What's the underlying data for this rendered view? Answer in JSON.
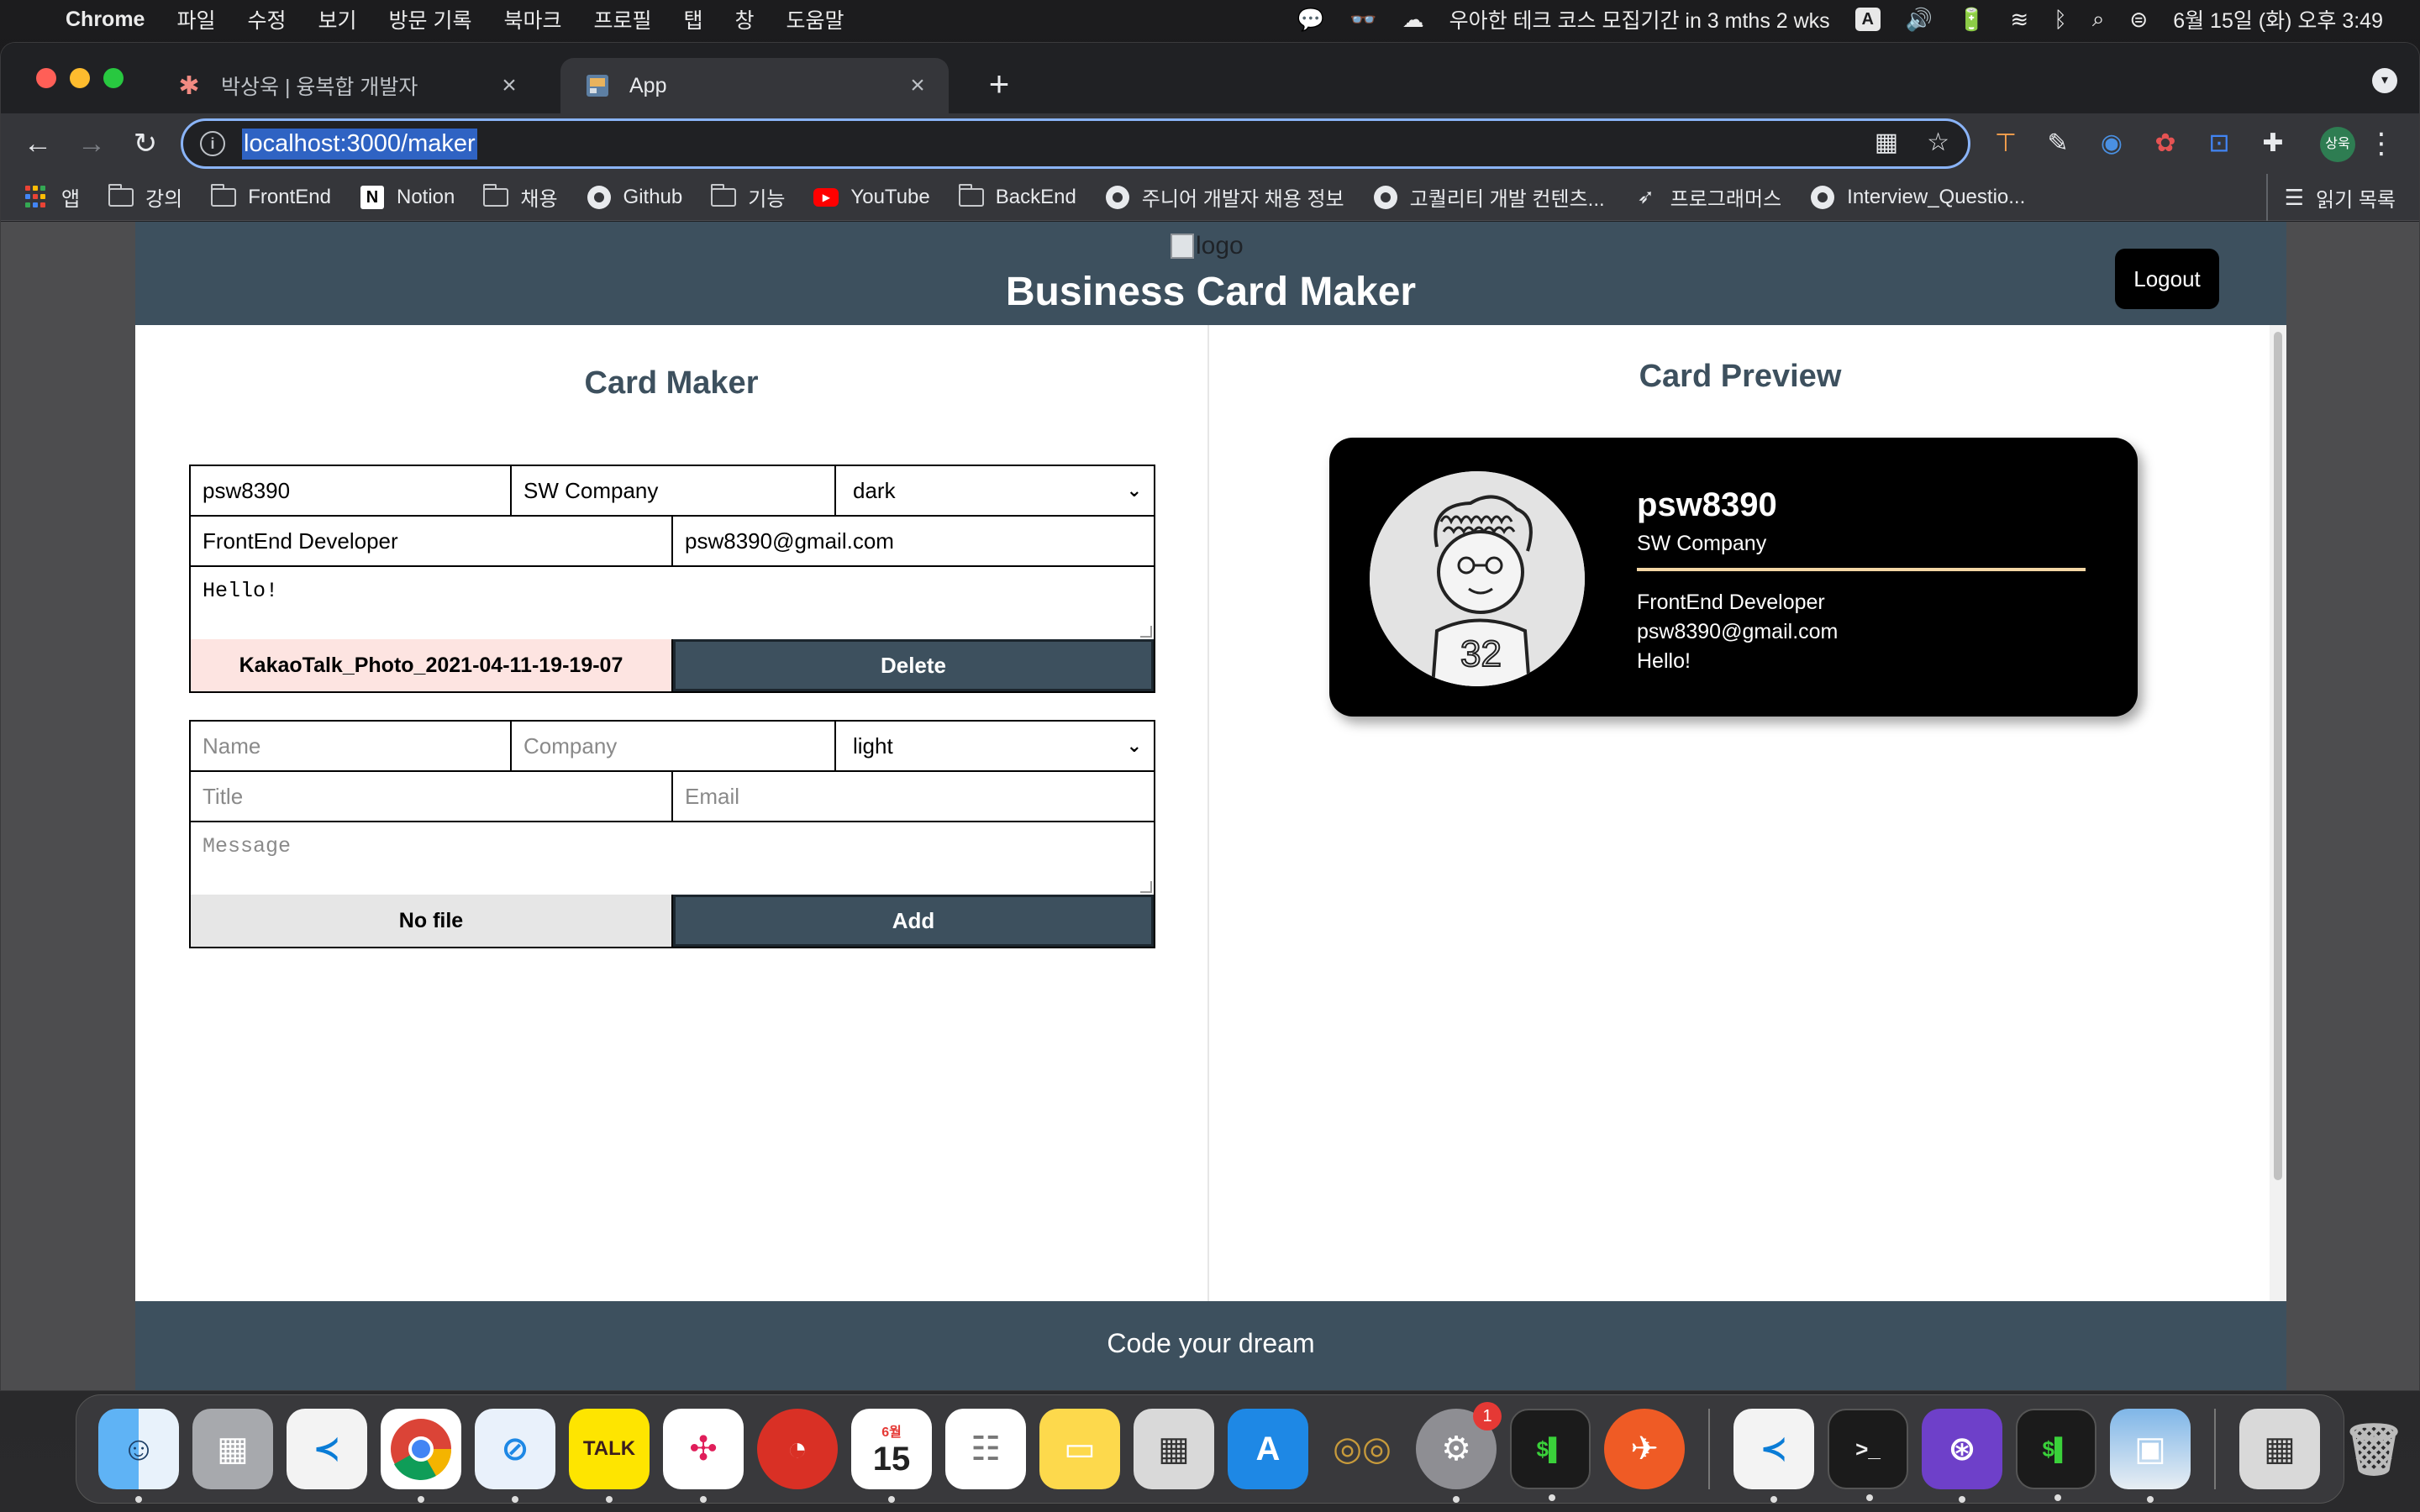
{
  "menubar": {
    "app_name": "Chrome",
    "menus": [
      "파일",
      "수정",
      "보기",
      "방문 기록",
      "북마크",
      "프로필",
      "탭",
      "창",
      "도움말"
    ],
    "status_text": "우아한 테크 코스 모집기간 in 3 mths 2 wks",
    "input_indicator": "A",
    "datetime": "6월 15일 (화) 오후 3:49"
  },
  "browser": {
    "tabs": [
      {
        "title": "박상욱 | 융복합 개발자",
        "active": false
      },
      {
        "title": "App",
        "active": true
      }
    ],
    "url": "localhost:3000/maker",
    "profile_initials": "상욱",
    "bookmarks": [
      {
        "label": "앱",
        "icon": "apps-icon"
      },
      {
        "label": "강의",
        "icon": "folder-icon"
      },
      {
        "label": "FrontEnd",
        "icon": "folder-icon"
      },
      {
        "label": "Notion",
        "icon": "notion-icon"
      },
      {
        "label": "채용",
        "icon": "folder-icon"
      },
      {
        "label": "Github",
        "icon": "github-icon"
      },
      {
        "label": "기능",
        "icon": "folder-icon"
      },
      {
        "label": "YouTube",
        "icon": "youtube-icon"
      },
      {
        "label": "BackEnd",
        "icon": "folder-icon"
      },
      {
        "label": "주니어 개발자 채용 정보",
        "icon": "github-icon"
      },
      {
        "label": "고퀄리티 개발 컨텐츠...",
        "icon": "github-icon"
      },
      {
        "label": "프로그래머스",
        "icon": "programmers-icon"
      },
      {
        "label": "Interview_Questio...",
        "icon": "github-icon"
      }
    ],
    "reading_list": "읽기 목록"
  },
  "app": {
    "logo_alt": "logo",
    "title": "Business Card Maker",
    "logout_label": "Logout",
    "footer": "Code your dream",
    "colors": {
      "header": "#3d505e",
      "accent_line": "#f3d6a4",
      "card_bg": "#000000"
    }
  },
  "maker": {
    "title": "Card Maker",
    "card_form": {
      "name": "psw8390",
      "company": "SW Company",
      "theme": "dark",
      "title": "FrontEnd Developer",
      "email": "psw8390@gmail.com",
      "message": "Hello!",
      "file_name": "KakaoTalk_Photo_2021-04-11-19-19-07",
      "button": "Delete"
    },
    "add_form": {
      "name_placeholder": "Name",
      "company_placeholder": "Company",
      "theme": "light",
      "title_placeholder": "Title",
      "email_placeholder": "Email",
      "message_placeholder": "Message",
      "file_label": "No file",
      "button": "Add"
    }
  },
  "preview": {
    "title": "Card Preview",
    "card": {
      "name": "psw8390",
      "company": "SW Company",
      "title": "FrontEnd Developer",
      "email": "psw8390@gmail.com",
      "message": "Hello!"
    }
  },
  "dock": {
    "apps": [
      "finder",
      "launchpad",
      "vscode",
      "chrome",
      "safari",
      "kakaotalk",
      "slack",
      "clock",
      "calendar",
      "reminders",
      "notes",
      "calculator",
      "app-store",
      "glasses",
      "system-preferences",
      "terminal",
      "postman",
      "vscode",
      "terminal",
      "github-desktop",
      "terminal",
      "preview",
      "calculator",
      "trash"
    ],
    "kakao_label": "TALK",
    "calendar_month": "6월",
    "calendar_day": "15",
    "prefs_badge": "1"
  }
}
